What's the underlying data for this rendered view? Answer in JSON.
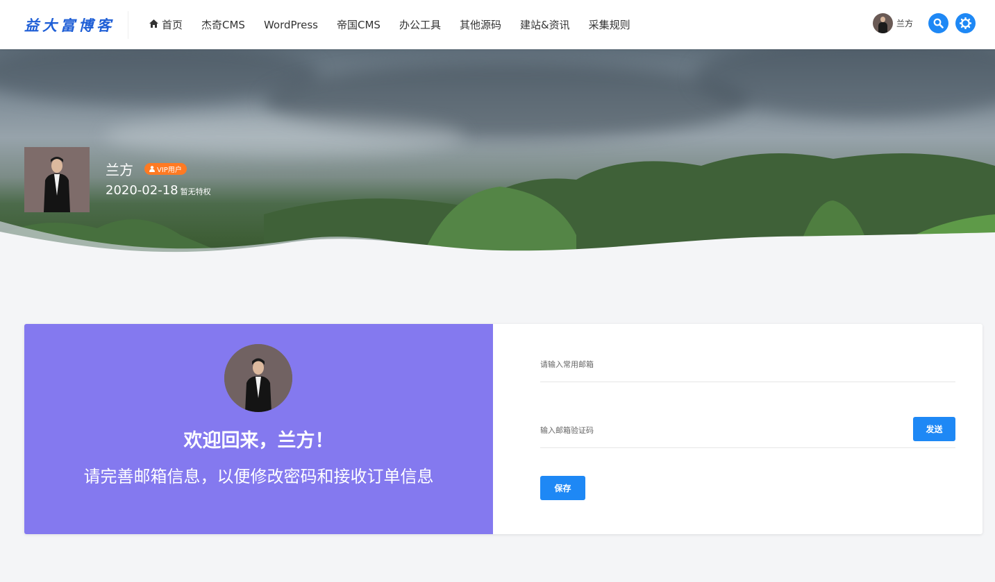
{
  "header": {
    "logo_text": "益大富博客",
    "nav": [
      {
        "label": "首页",
        "icon": "home-icon"
      },
      {
        "label": "杰奇CMS"
      },
      {
        "label": "WordPress"
      },
      {
        "label": "帝国CMS"
      },
      {
        "label": "办公工具"
      },
      {
        "label": "其他源码"
      },
      {
        "label": "建站&资讯"
      },
      {
        "label": "采集规则"
      }
    ],
    "user_name": "兰方",
    "icons": [
      "user-avatar",
      "search-icon",
      "gear-icon"
    ],
    "accent_color": "#1e88f5"
  },
  "profile": {
    "name": "兰方",
    "badge": "VIP用户",
    "date": "2020-02-18",
    "privilege": "暂无特权",
    "badge_color": "#ff7a23"
  },
  "welcome": {
    "title": "欢迎回来，兰方！",
    "subtitle": "请完善邮箱信息，以便修改密码和接收订单信息",
    "panel_color": "#8479ef"
  },
  "form": {
    "email_placeholder": "请输入常用邮箱",
    "code_placeholder": "输入邮箱验证码",
    "send_label": "发送",
    "save_label": "保存"
  }
}
